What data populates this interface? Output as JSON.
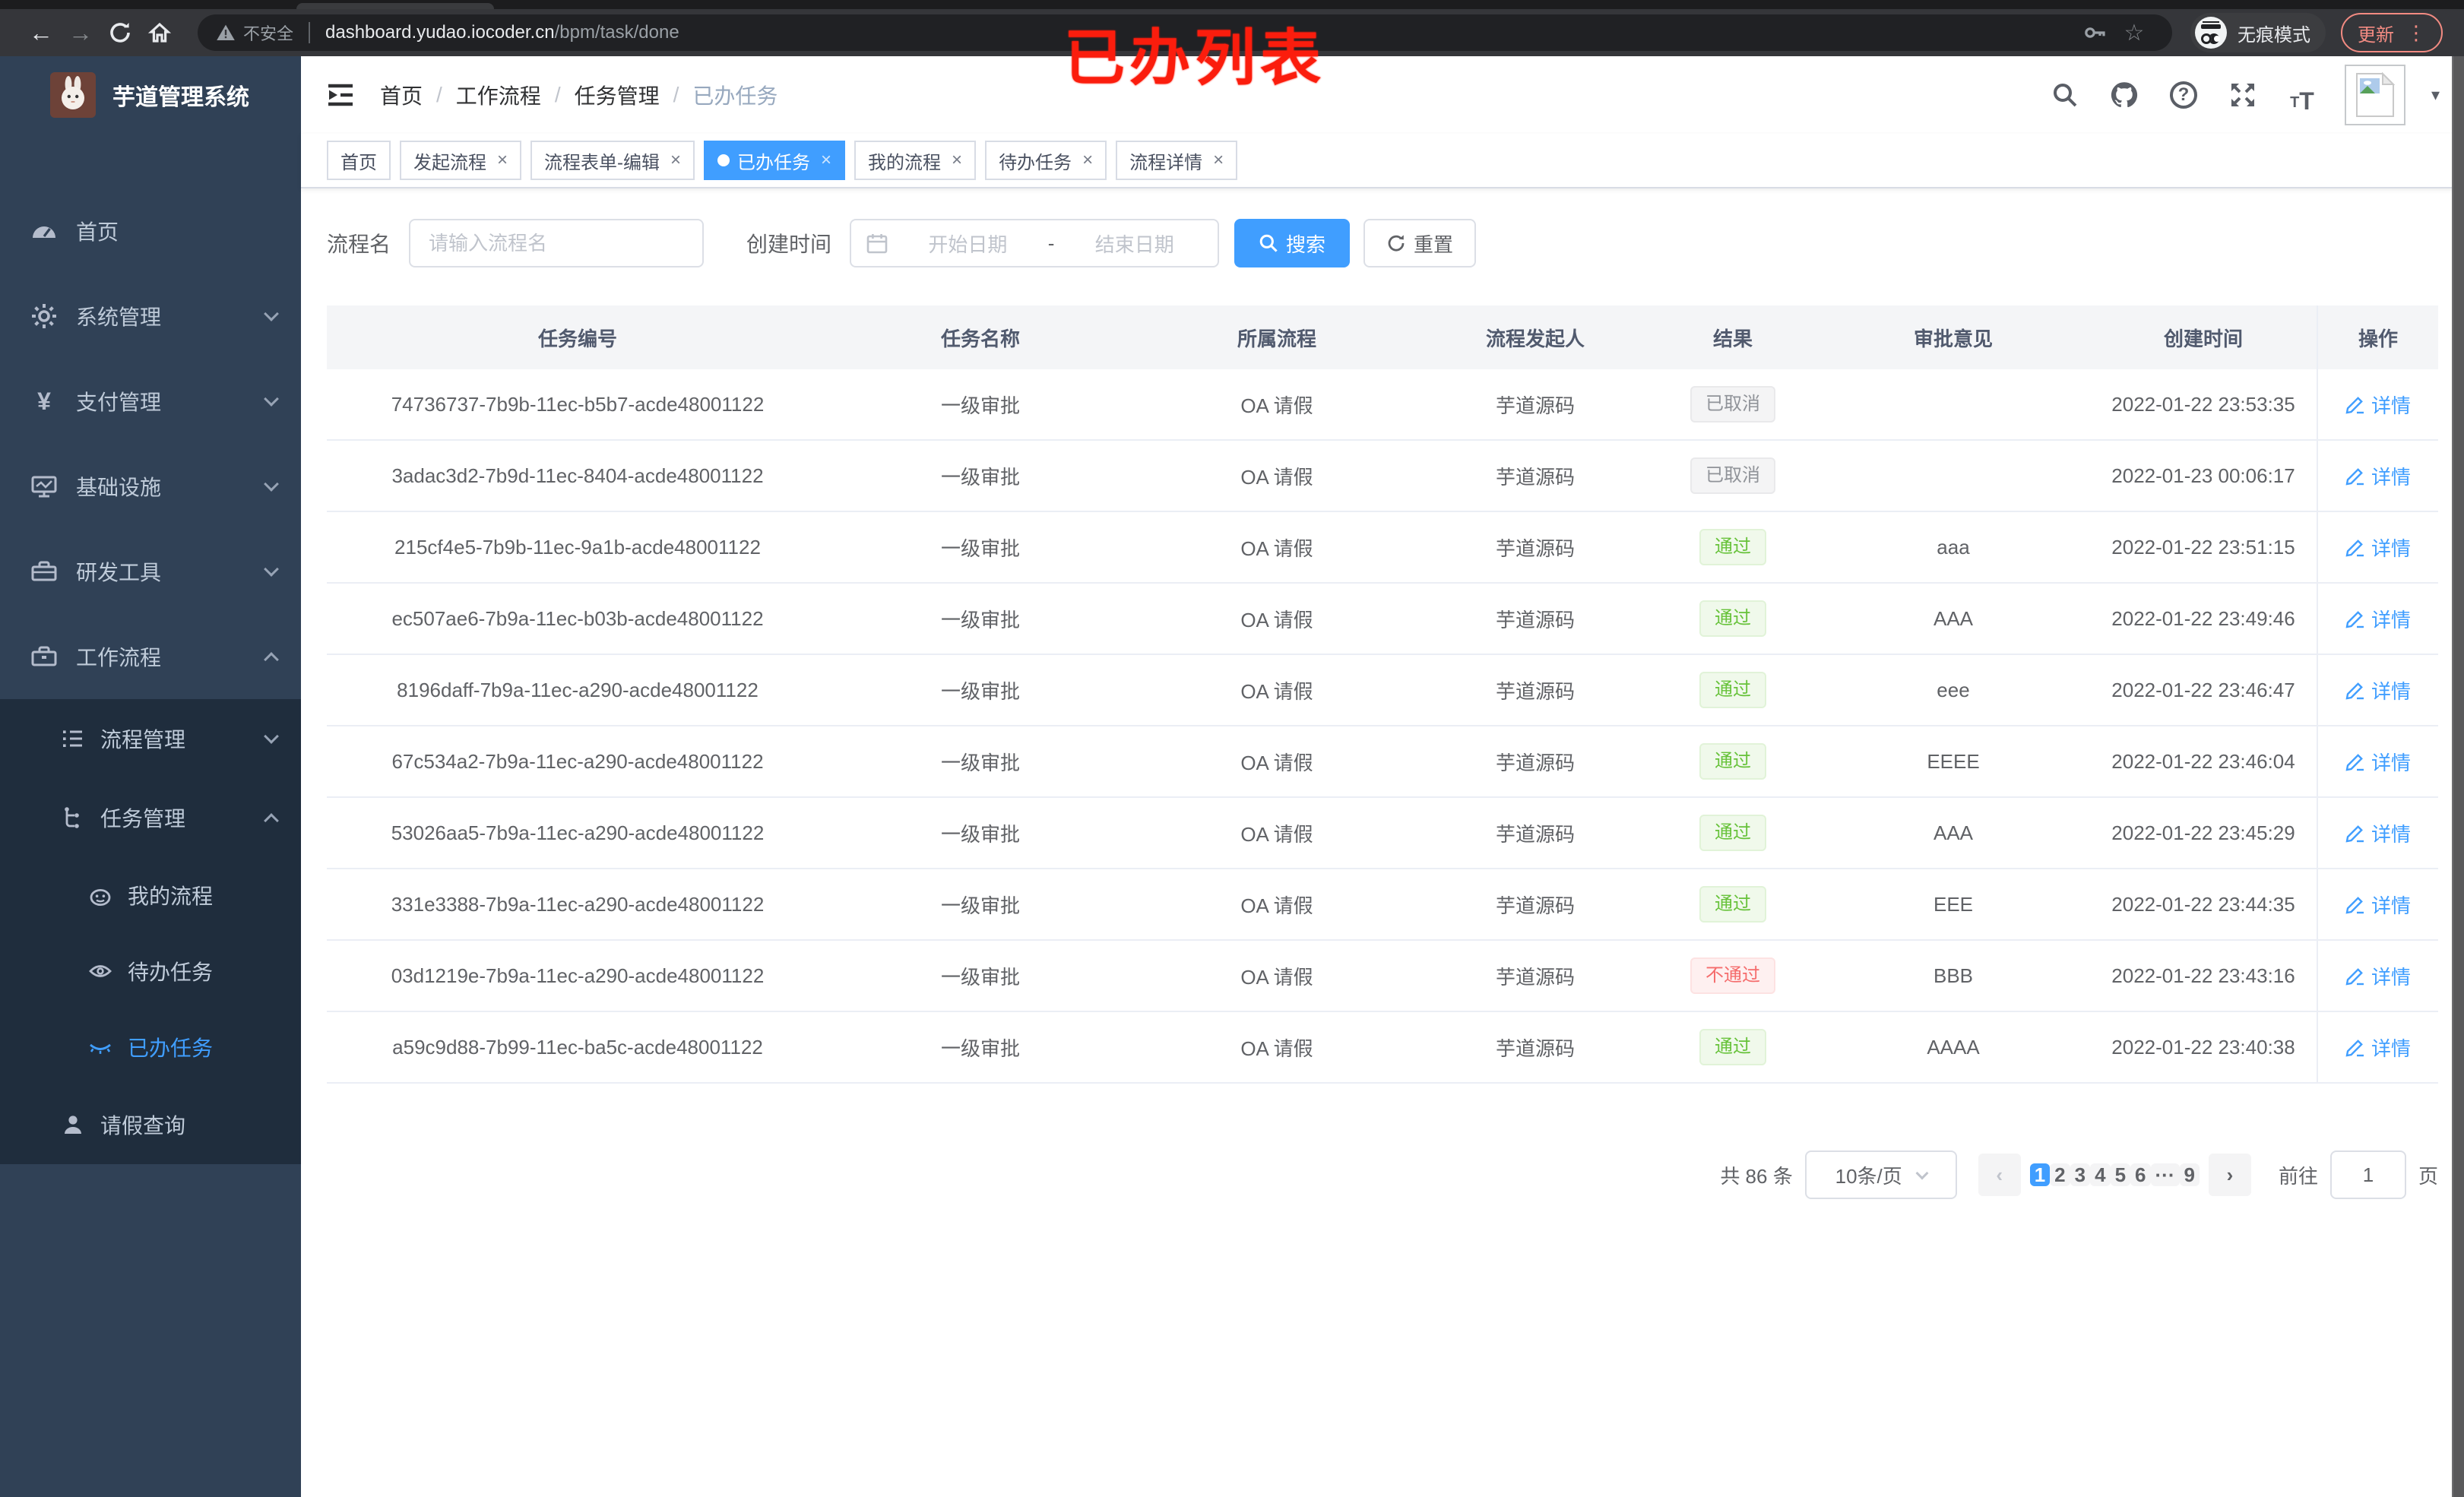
{
  "browser": {
    "security_label": "不安全",
    "url_host": "dashboard.yudao.iocoder.cn",
    "url_path": "/bpm/task/done",
    "incognito_label": "无痕模式",
    "update_label": "更新",
    "menu_dots": "⋮",
    "back_glyph": "←",
    "forward_glyph": "→",
    "star_glyph": "☆"
  },
  "annotation": {
    "title": "已办列表"
  },
  "sidebar": {
    "app_title": "芋道管理系统",
    "home": "首页",
    "system": "系统管理",
    "payment": "支付管理",
    "payment_glyph": "¥",
    "infra": "基础设施",
    "devtools": "研发工具",
    "workflow": "工作流程",
    "process_mgmt": "流程管理",
    "task_mgmt": "任务管理",
    "my_process": "我的流程",
    "todo_tasks": "待办任务",
    "done_tasks": "已办任务",
    "leave_query": "请假查询"
  },
  "breadcrumb": {
    "items": [
      "首页",
      "工作流程",
      "任务管理",
      "已办任务"
    ],
    "separator": "/"
  },
  "header_icons": {
    "caret_glyph": "▾"
  },
  "tabs": [
    {
      "label": "首页",
      "closable": false,
      "active": false
    },
    {
      "label": "发起流程",
      "closable": true,
      "active": false
    },
    {
      "label": "流程表单-编辑",
      "closable": true,
      "active": false
    },
    {
      "label": "已办任务",
      "closable": true,
      "active": true
    },
    {
      "label": "我的流程",
      "closable": true,
      "active": false
    },
    {
      "label": "待办任务",
      "closable": true,
      "active": false
    },
    {
      "label": "流程详情",
      "closable": true,
      "active": false
    }
  ],
  "filters": {
    "name_label": "流程名",
    "name_placeholder": "请输入流程名",
    "time_label": "创建时间",
    "start_placeholder": "开始日期",
    "range_separator": "-",
    "end_placeholder": "结束日期",
    "search_label": "搜索",
    "reset_label": "重置"
  },
  "table": {
    "columns": [
      "任务编号",
      "任务名称",
      "所属流程",
      "流程发起人",
      "结果",
      "审批意见",
      "创建时间",
      "操作"
    ],
    "rows": [
      {
        "id": "74736737-7b9b-11ec-b5b7-acde48001122",
        "name": "一级审批",
        "process": "OA 请假",
        "starter": "芋道源码",
        "result": "已取消",
        "result_type": "cancel",
        "opinion": "",
        "created": "2022-01-22 23:53:35",
        "action": "详情"
      },
      {
        "id": "3adac3d2-7b9d-11ec-8404-acde48001122",
        "name": "一级审批",
        "process": "OA 请假",
        "starter": "芋道源码",
        "result": "已取消",
        "result_type": "cancel",
        "opinion": "",
        "created": "2022-01-23 00:06:17",
        "action": "详情"
      },
      {
        "id": "215cf4e5-7b9b-11ec-9a1b-acde48001122",
        "name": "一级审批",
        "process": "OA 请假",
        "starter": "芋道源码",
        "result": "通过",
        "result_type": "pass",
        "opinion": "aaa",
        "created": "2022-01-22 23:51:15",
        "action": "详情"
      },
      {
        "id": "ec507ae6-7b9a-11ec-b03b-acde48001122",
        "name": "一级审批",
        "process": "OA 请假",
        "starter": "芋道源码",
        "result": "通过",
        "result_type": "pass",
        "opinion": "AAA",
        "created": "2022-01-22 23:49:46",
        "action": "详情"
      },
      {
        "id": "8196daff-7b9a-11ec-a290-acde48001122",
        "name": "一级审批",
        "process": "OA 请假",
        "starter": "芋道源码",
        "result": "通过",
        "result_type": "pass",
        "opinion": "eee",
        "created": "2022-01-22 23:46:47",
        "action": "详情"
      },
      {
        "id": "67c534a2-7b9a-11ec-a290-acde48001122",
        "name": "一级审批",
        "process": "OA 请假",
        "starter": "芋道源码",
        "result": "通过",
        "result_type": "pass",
        "opinion": "EEEE",
        "created": "2022-01-22 23:46:04",
        "action": "详情"
      },
      {
        "id": "53026aa5-7b9a-11ec-a290-acde48001122",
        "name": "一级审批",
        "process": "OA 请假",
        "starter": "芋道源码",
        "result": "通过",
        "result_type": "pass",
        "opinion": "AAA",
        "created": "2022-01-22 23:45:29",
        "action": "详情"
      },
      {
        "id": "331e3388-7b9a-11ec-a290-acde48001122",
        "name": "一级审批",
        "process": "OA 请假",
        "starter": "芋道源码",
        "result": "通过",
        "result_type": "pass",
        "opinion": "EEE",
        "created": "2022-01-22 23:44:35",
        "action": "详情"
      },
      {
        "id": "03d1219e-7b9a-11ec-a290-acde48001122",
        "name": "一级审批",
        "process": "OA 请假",
        "starter": "芋道源码",
        "result": "不通过",
        "result_type": "fail",
        "opinion": "BBB",
        "created": "2022-01-22 23:43:16",
        "action": "详情"
      },
      {
        "id": "a59c9d88-7b99-11ec-ba5c-acde48001122",
        "name": "一级审批",
        "process": "OA 请假",
        "starter": "芋道源码",
        "result": "通过",
        "result_type": "pass",
        "opinion": "AAAA",
        "created": "2022-01-22 23:40:38",
        "action": "详情"
      }
    ]
  },
  "pagination": {
    "total_text": "共 86 条",
    "page_size_text": "10条/页",
    "prev_glyph": "‹",
    "next_glyph": "›",
    "pages": [
      {
        "label": "1",
        "active": true
      },
      {
        "label": "2",
        "active": false
      },
      {
        "label": "3",
        "active": false
      },
      {
        "label": "4",
        "active": false
      },
      {
        "label": "5",
        "active": false
      },
      {
        "label": "6",
        "active": false
      },
      {
        "label": "···",
        "active": false
      },
      {
        "label": "9",
        "active": false
      }
    ],
    "goto_label": "前往",
    "goto_value": "1",
    "page_unit": "页"
  },
  "colors": {
    "primary": "#409eff",
    "sidebar_bg": "#304156",
    "submenu_bg": "#1f2d3d",
    "success": "#67c23a",
    "danger": "#f56c6c",
    "info": "#909399",
    "annotation_red": "#fb1d0d"
  }
}
